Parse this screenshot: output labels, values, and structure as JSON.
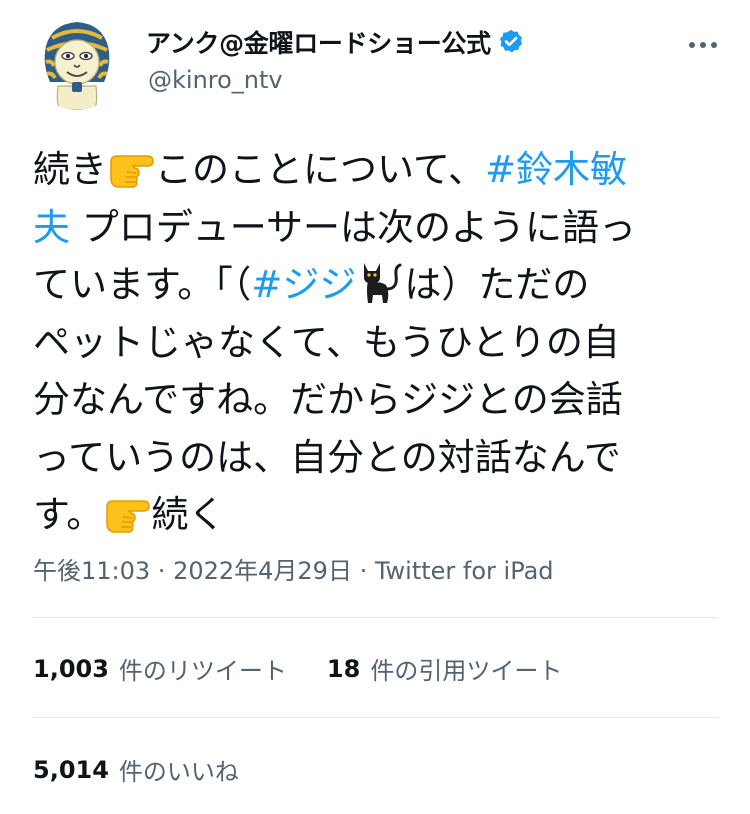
{
  "user": {
    "display_name": "アンク@金曜ロードショー公式",
    "handle": "@kinro_ntv",
    "verified": true,
    "avatar_icon": "sphinx-mascot-avatar",
    "more_icon": "more-horizontal-icon"
  },
  "tweet": {
    "lines": [
      [
        {
          "t": "続き"
        },
        {
          "emoji": "pointing-right-hand"
        },
        {
          "t": "このことについて、"
        },
        {
          "t": "#鈴木敏",
          "tag": true
        }
      ],
      [
        {
          "t": "夫",
          "tag": true
        },
        {
          "t": " プロデューサーは次のように語っ"
        }
      ],
      [
        {
          "t": "ています。「（"
        },
        {
          "t": "#ジジ",
          "tag": true
        },
        {
          "emoji": "black-cat"
        },
        {
          "t": "は）ただの"
        }
      ],
      [
        {
          "t": "ペットじゃなくて、もうひとりの自"
        }
      ],
      [
        {
          "t": "分なんですね。だからジジとの会話"
        }
      ],
      [
        {
          "t": "っていうのは、自分との対話なんで"
        }
      ],
      [
        {
          "t": "す。"
        },
        {
          "emoji": "pointing-right-hand"
        },
        {
          "t": "続く"
        }
      ]
    ]
  },
  "meta": {
    "time": "午後11:03",
    "separator": " · ",
    "date": "2022年4月29日",
    "source": "Twitter for iPad"
  },
  "stats": {
    "retweets_count": "1,003",
    "retweets_label": "件のリツイート",
    "quotes_count": "18",
    "quotes_label": "件の引用ツイート",
    "likes_count": "5,014",
    "likes_label": "件のいいね"
  },
  "colors": {
    "link": "#1d9bf0",
    "text": "#0f1419",
    "secondary": "#536471",
    "divider": "#e1e8ed"
  }
}
